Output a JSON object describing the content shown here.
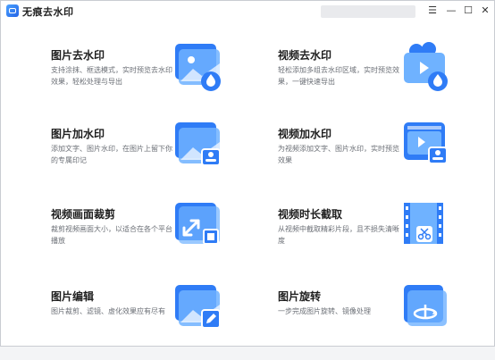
{
  "app": {
    "title": "无痕去水印"
  },
  "window_controls": {
    "menu": "☰",
    "minimize": "—",
    "maximize": "☐",
    "close": "✕"
  },
  "cards": [
    {
      "title": "图片去水印",
      "desc": "支持涂抹、框选模式，实时预览去水印效果，轻松处理与导出",
      "icon": "image-remove-watermark-icon"
    },
    {
      "title": "视频去水印",
      "desc": "轻松添加多组去水印区域，实时预览效果，一键快速导出",
      "icon": "video-remove-watermark-icon"
    },
    {
      "title": "图片加水印",
      "desc": "添加文字、图片水印，在图片上留下你的专属印记",
      "icon": "image-add-watermark-icon"
    },
    {
      "title": "视频加水印",
      "desc": "为视频添加文字、图片水印，实时预览效果",
      "icon": "video-add-watermark-icon"
    },
    {
      "title": "视频画面裁剪",
      "desc": "裁剪视频画面大小，以适合在各个平台播放",
      "icon": "video-crop-icon"
    },
    {
      "title": "视频时长截取",
      "desc": "从视频中截取精彩片段，且不损失清晰度",
      "icon": "video-trim-icon"
    },
    {
      "title": "图片编辑",
      "desc": "图片裁剪、滤镜、虚化效果应有尽有",
      "icon": "image-edit-icon"
    },
    {
      "title": "图片旋转",
      "desc": "一步完成图片旋转、镜像处理",
      "icon": "image-rotate-icon"
    }
  ]
}
